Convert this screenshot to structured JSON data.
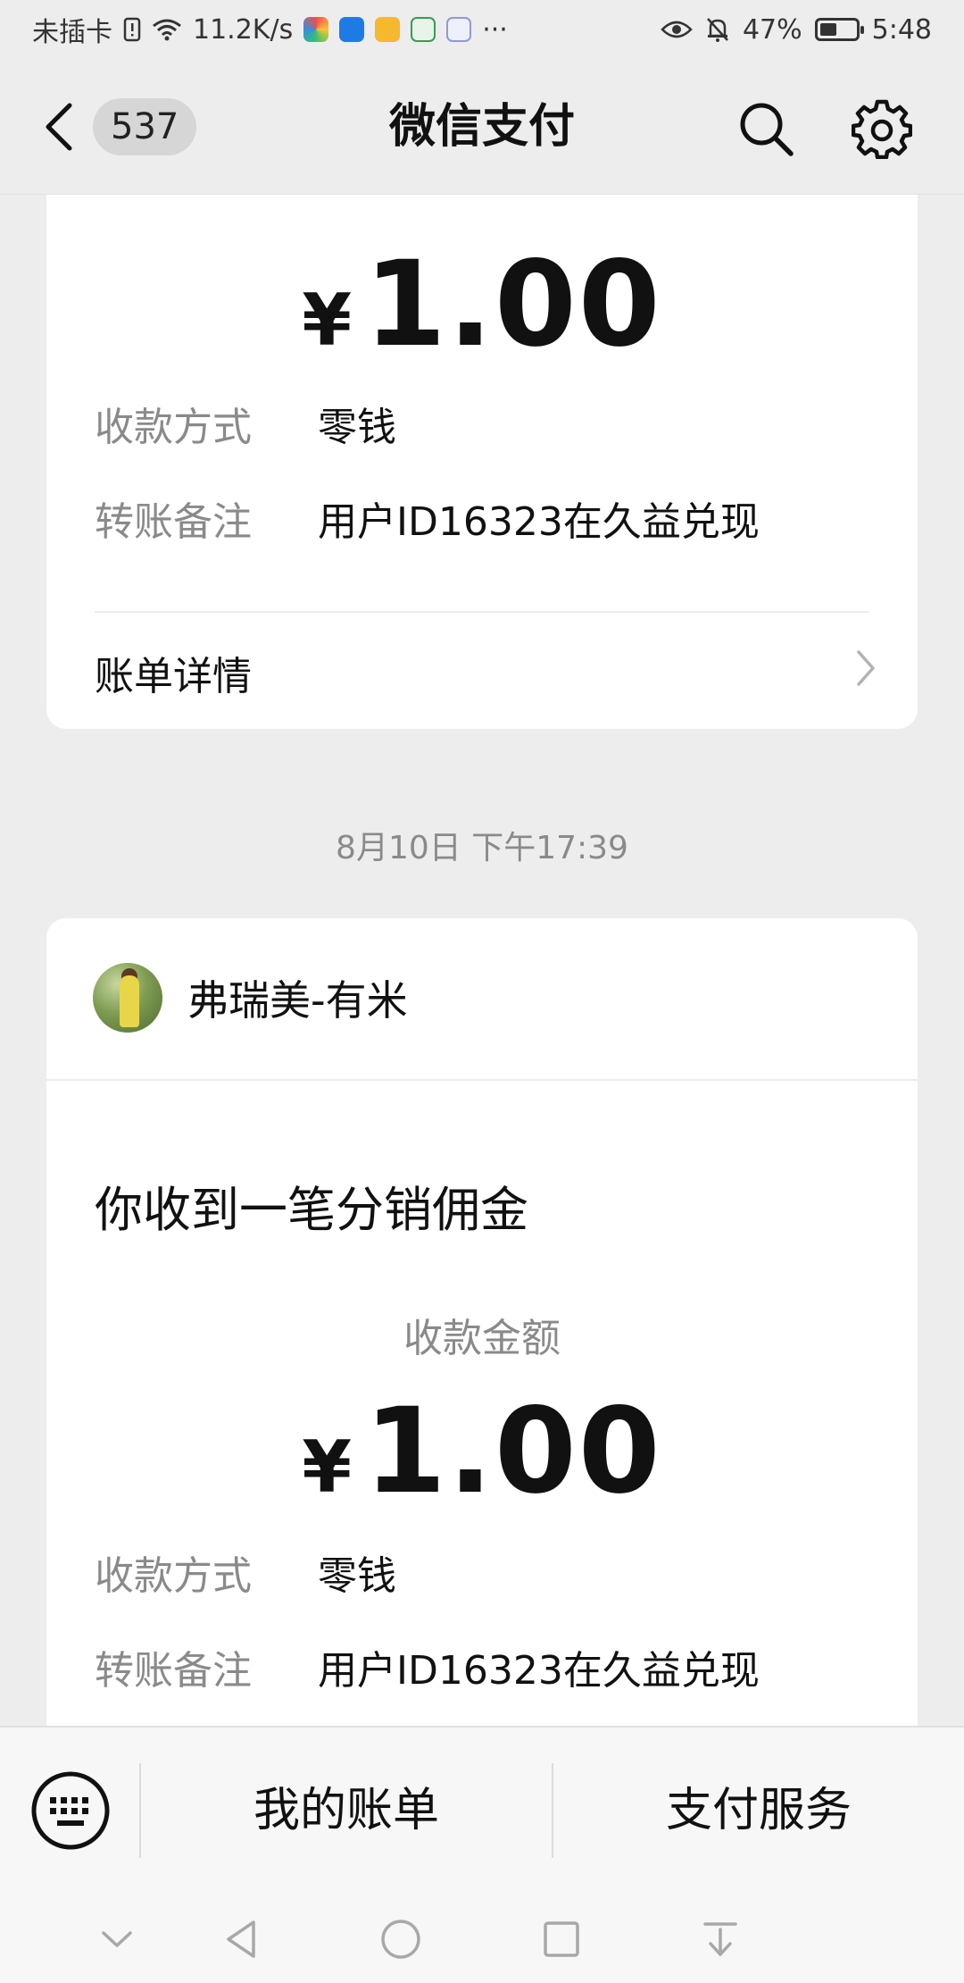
{
  "status_bar": {
    "carrier": "未插卡",
    "net_speed": "11.2K/s",
    "more": "···",
    "battery": "47%",
    "battery_level": 0.47,
    "time": "5:48"
  },
  "header": {
    "unread_count": "537",
    "title": "微信支付"
  },
  "card1": {
    "amount_currency": "¥",
    "amount_value": "1.00",
    "rows": [
      {
        "label": "收款方式",
        "value": "零钱"
      },
      {
        "label": "转账备注",
        "value": "用户ID16323在久益兑现"
      }
    ],
    "bill_detail_label": "账单详情"
  },
  "time_label": "8月10日 下午17:39",
  "card2": {
    "sender_name": "弗瑞美-有米",
    "notice_title": "你收到一笔分销佣金",
    "amount_caption": "收款金额",
    "amount_currency": "¥",
    "amount_value": "1.00",
    "rows": [
      {
        "label": "收款方式",
        "value": "零钱"
      },
      {
        "label": "转账备注",
        "value": "用户ID16323在久益兑现"
      }
    ]
  },
  "bottom_menu": {
    "items": [
      "我的账单",
      "支付服务"
    ]
  },
  "colors": {
    "background": "#ededed",
    "card": "#ffffff",
    "secondary_text": "#8a8a8a"
  }
}
